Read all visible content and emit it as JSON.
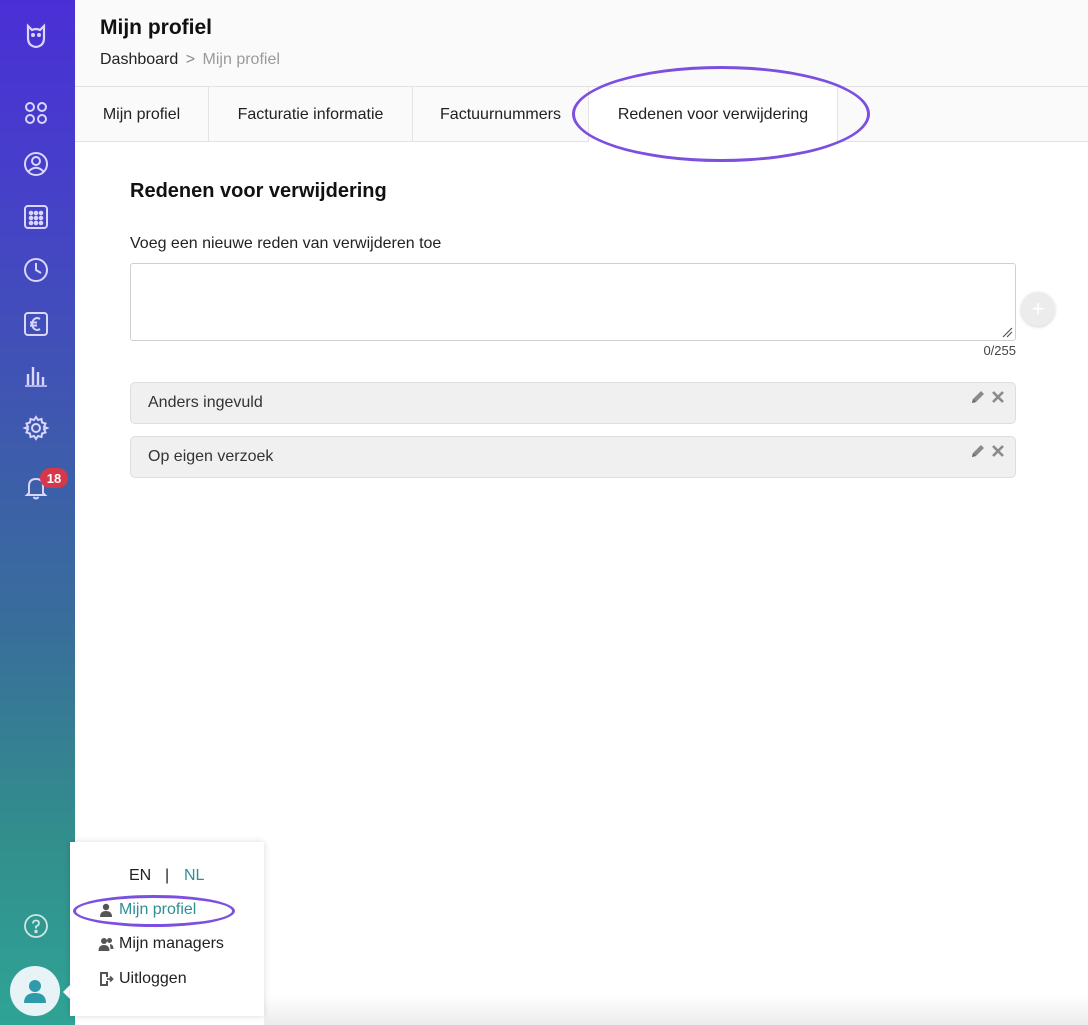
{
  "header": {
    "title": "Mijn profiel",
    "breadcrumb": {
      "home": "Dashboard",
      "separator": ">",
      "current": "Mijn profiel"
    }
  },
  "tabs": [
    {
      "label": "Mijn profiel",
      "active": false
    },
    {
      "label": "Facturatie informatie",
      "active": false
    },
    {
      "label": "Factuurnummers",
      "active": false
    },
    {
      "label": "Redenen voor verwijdering",
      "active": true
    }
  ],
  "sidebar": {
    "icons": [
      "app-logo-icon",
      "dashboard-icon",
      "user-icon",
      "calendar-icon",
      "clock-icon",
      "euro-icon",
      "chart-icon",
      "settings-icon",
      "bell-icon",
      "help-icon",
      "avatar-icon"
    ],
    "notification_count": "18"
  },
  "main": {
    "section_title": "Redenen voor verwijdering",
    "input_label": "Voeg een nieuwe reden van verwijderen toe",
    "input_value": "",
    "char_count": "0/255",
    "add_button_glyph": "+",
    "reasons": [
      {
        "label": "Anders ingevuld"
      },
      {
        "label": "Op eigen verzoek"
      }
    ]
  },
  "profile_menu": {
    "lang_en": "EN",
    "lang_sep": "|",
    "lang_nl": "NL",
    "items": [
      {
        "label": "Mijn profiel",
        "icon": "user-icon",
        "current": true
      },
      {
        "label": "Mijn managers",
        "icon": "users-icon",
        "current": false
      },
      {
        "label": "Uitloggen",
        "icon": "logout-icon",
        "current": false
      }
    ]
  },
  "colors": {
    "sidebar_top": "#4a2fd6",
    "sidebar_bottom": "#2fa396",
    "accent_teal": "#2f8f96",
    "highlight_purple": "#7b4fe0",
    "badge_red": "#d4384a"
  }
}
